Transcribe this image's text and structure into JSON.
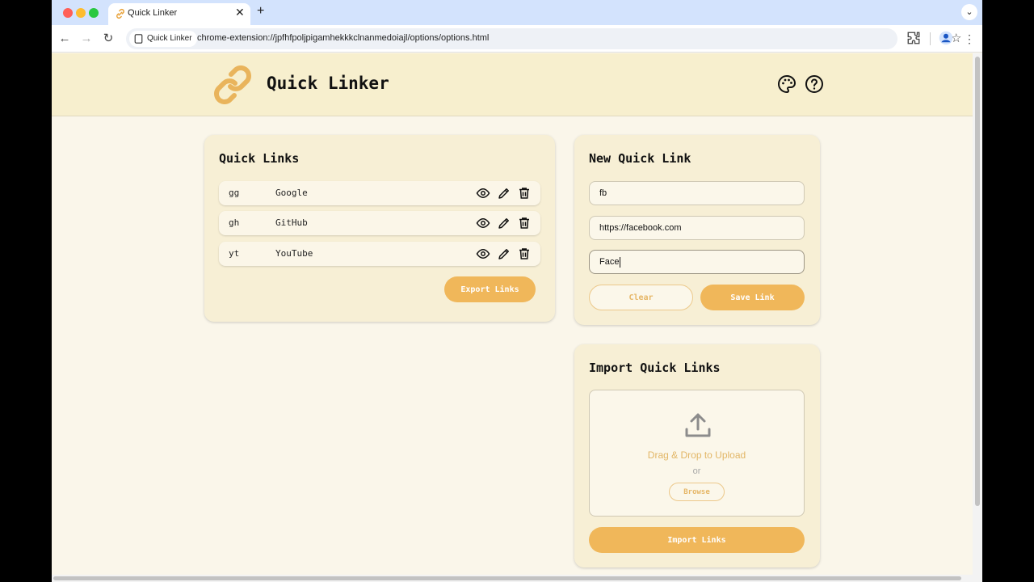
{
  "browser": {
    "tab_title": "Quick Linker",
    "site_chip": "Quick Linker",
    "url": "chrome-extension://jpfhfpoljpigamhekkkclnanmedoiajl/options/options.html"
  },
  "header": {
    "title": "Quick Linker"
  },
  "quick_links": {
    "title": "Quick Links",
    "items": [
      {
        "key": "gg",
        "name": "Google"
      },
      {
        "key": "gh",
        "name": "GitHub"
      },
      {
        "key": "yt",
        "name": "YouTube"
      }
    ],
    "export_label": "Export Links"
  },
  "new_link": {
    "title": "New Quick Link",
    "key_value": "fb",
    "url_value": "https://facebook.com",
    "name_value": "Face",
    "clear_label": "Clear",
    "save_label": "Save Link"
  },
  "import": {
    "title": "Import Quick Links",
    "drop_text": "Drag & Drop to Upload",
    "or_text": "or",
    "browse_label": "Browse",
    "import_label": "Import Links"
  },
  "colors": {
    "accent": "#f0b75a",
    "header_bg": "#f7efce",
    "card_bg": "#f7efd5",
    "page_bg": "#faf6ea"
  },
  "icons": {
    "logo": "chain-link-icon",
    "theme": "palette-icon",
    "help": "help-circle-icon",
    "view": "eye-icon",
    "edit": "pencil-icon",
    "delete": "trash-icon",
    "upload": "upload-icon"
  }
}
